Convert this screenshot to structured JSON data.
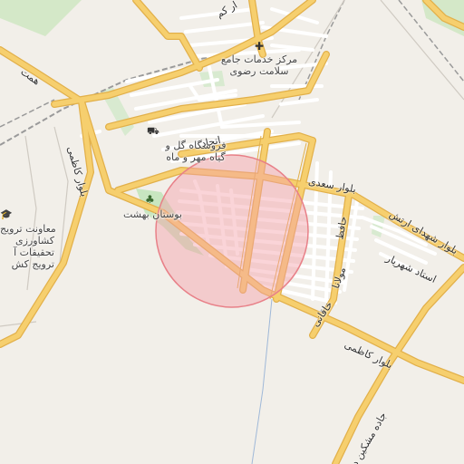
{
  "map": {
    "search_circle": {
      "fill": "#f4a0a8",
      "stroke": "#e88088"
    },
    "colors": {
      "background": "#f2efe9",
      "major_road": "#f6cf6e",
      "major_road_casing": "#e2b04a",
      "minor_road": "#ffffff",
      "park": "#c8e6c0",
      "railway": "#9a9a9a"
    }
  },
  "pois": {
    "health_center": {
      "icon": "plus-icon",
      "label_line1": "مرکز خدمات جامع",
      "label_line2": "سلامت رضوی"
    },
    "flower_shop": {
      "icon": "shopping-bag-icon",
      "label_line1": "فروشگاه گل و",
      "label_line2": "گیاه مهر و ماه"
    },
    "park": {
      "icon": "tree-icon",
      "label": "بوستان بهشت"
    },
    "agri_office": {
      "icon": "graduation-cap-icon",
      "label_line1": "معاونت ترویج",
      "label_line2": "کشاورزی",
      "label_line3": "تحقیقات آ",
      "label_line4": "ترویج کش"
    }
  },
  "roads": {
    "saadi": "بلوار سعدی",
    "kazemi_left": "بلوار کاظمی",
    "kazemi_bottom": "بلوار کاظمی",
    "shohada_artesh": "بلوار شهدای ارتش",
    "ostad_shahriar": "استاد شهریار",
    "hafez": "حافظ",
    "mowlana": "مولانا",
    "khaqani": "خاقانی",
    "ettehad": "اتحاد",
    "mashkin": "جاده مشکین د",
    "top_blvd": "ار کم",
    "hemmat": "همت"
  }
}
